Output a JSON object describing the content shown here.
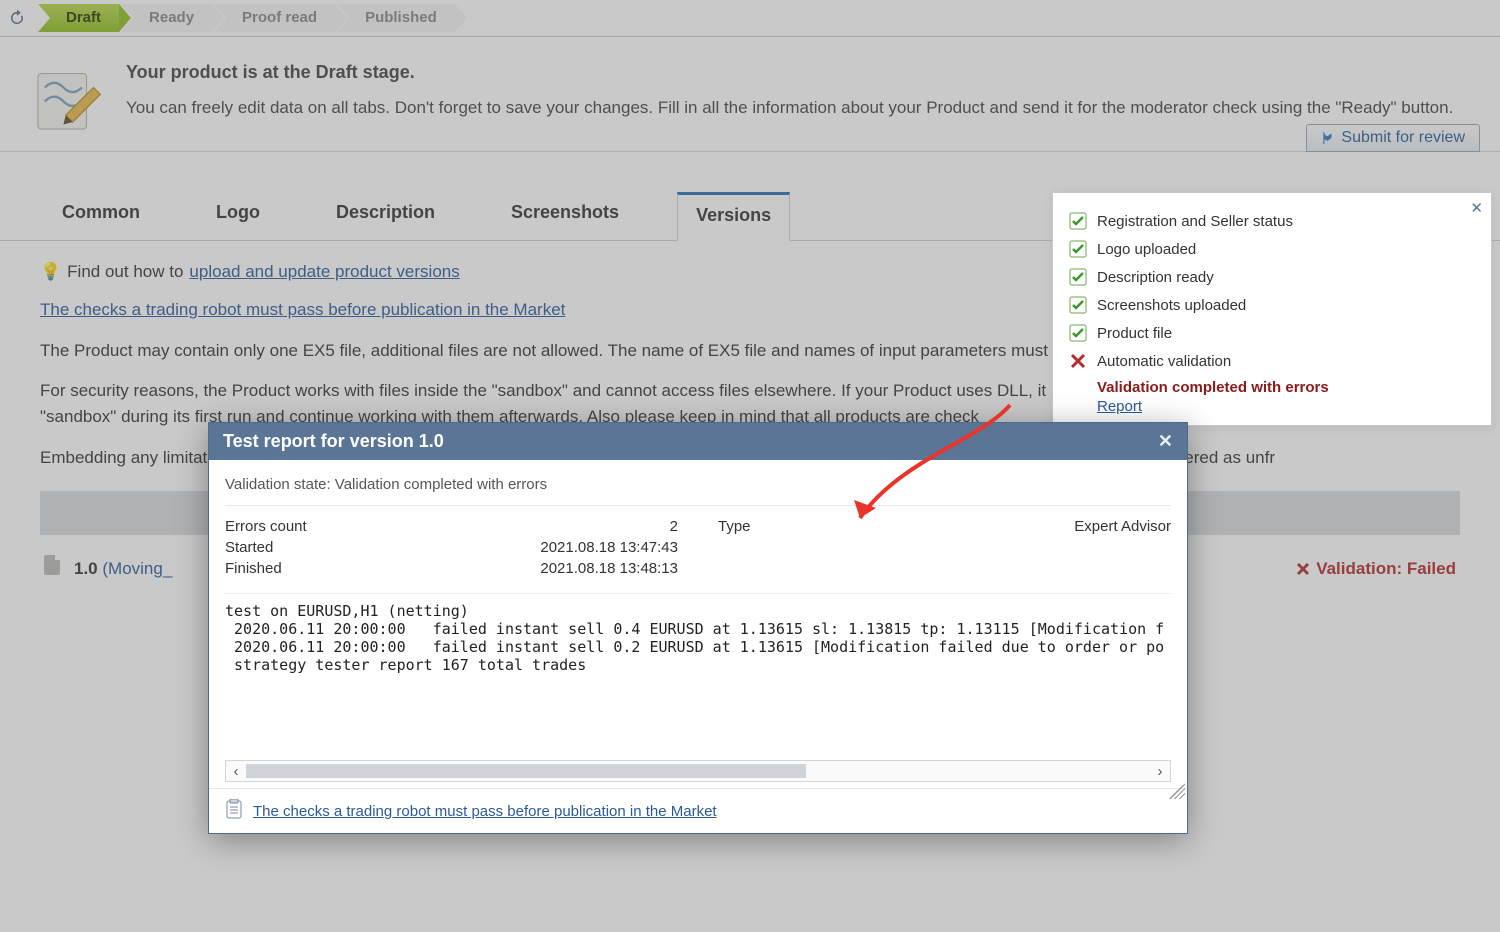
{
  "workflow": {
    "stages": [
      "Draft",
      "Ready",
      "Proof read",
      "Published"
    ],
    "active": "Draft"
  },
  "info": {
    "title": "Your product is at the Draft stage.",
    "body": "You can freely edit data on all tabs. Don't forget to save your changes. Fill in all the information about your Product and send it for the moderator check using the \"Ready\" button."
  },
  "submit_button": "Submit for review",
  "checklist": {
    "items": [
      {
        "ok": true,
        "label": "Registration and Seller status"
      },
      {
        "ok": true,
        "label": "Logo uploaded"
      },
      {
        "ok": true,
        "label": "Description ready"
      },
      {
        "ok": true,
        "label": "Screenshots uploaded"
      },
      {
        "ok": true,
        "label": "Product file"
      },
      {
        "ok": false,
        "label": "Automatic validation"
      }
    ],
    "error_title": "Validation completed with errors",
    "report_link": "Report"
  },
  "tabs": [
    "Common",
    "Logo",
    "Description",
    "Screenshots",
    "Versions"
  ],
  "active_tab": "Versions",
  "hint": {
    "prefix": "Find out how to ",
    "link": "upload and update product versions"
  },
  "checks_link": "The checks a trading robot must pass before publication in the Market",
  "paragraphs": [
    "The Product may contain only one EX5 file, additional files are not allowed. The name of EX5 file and names of input parameters must contain only Latin characters. T",
    "For security reasons, the Product works with files inside the \"sandbox\" and cannot access files elsewhere. If your Product uses DLL, it must create the necessary file and folders inside the \"sandbox\" during its first run and continue working with them afterwards. Also please keep in mind that all products are check",
    "Embedding any limitations (account number, broker, time, etc.) into the full versions of free or paid Products is prohibited. Such restrictions will be considered as unfr"
  ],
  "version_row": {
    "version": "1.0",
    "name": "(Moving_",
    "status": "Validation: Failed"
  },
  "modal": {
    "title": "Test report for version 1.0",
    "state_label": "Validation state:",
    "state_value": "Validation completed with errors",
    "left": [
      {
        "k": "Errors count",
        "v": "2"
      },
      {
        "k": "Started",
        "v": "2021.08.18 13:47:43"
      },
      {
        "k": "Finished",
        "v": "2021.08.18 13:48:13"
      }
    ],
    "right": [
      {
        "k": "Type",
        "v": "Expert Advisor"
      }
    ],
    "log": "test on EURUSD,H1 (netting)\n 2020.06.11 20:00:00   failed instant sell 0.4 EURUSD at 1.13615 sl: 1.13815 tp: 1.13115 [Modification f\n 2020.06.11 20:00:00   failed instant sell 0.2 EURUSD at 1.13615 [Modification failed due to order or po\n strategy tester report 167 total trades",
    "footer_link": "The checks a trading robot must pass before publication in the Market"
  }
}
